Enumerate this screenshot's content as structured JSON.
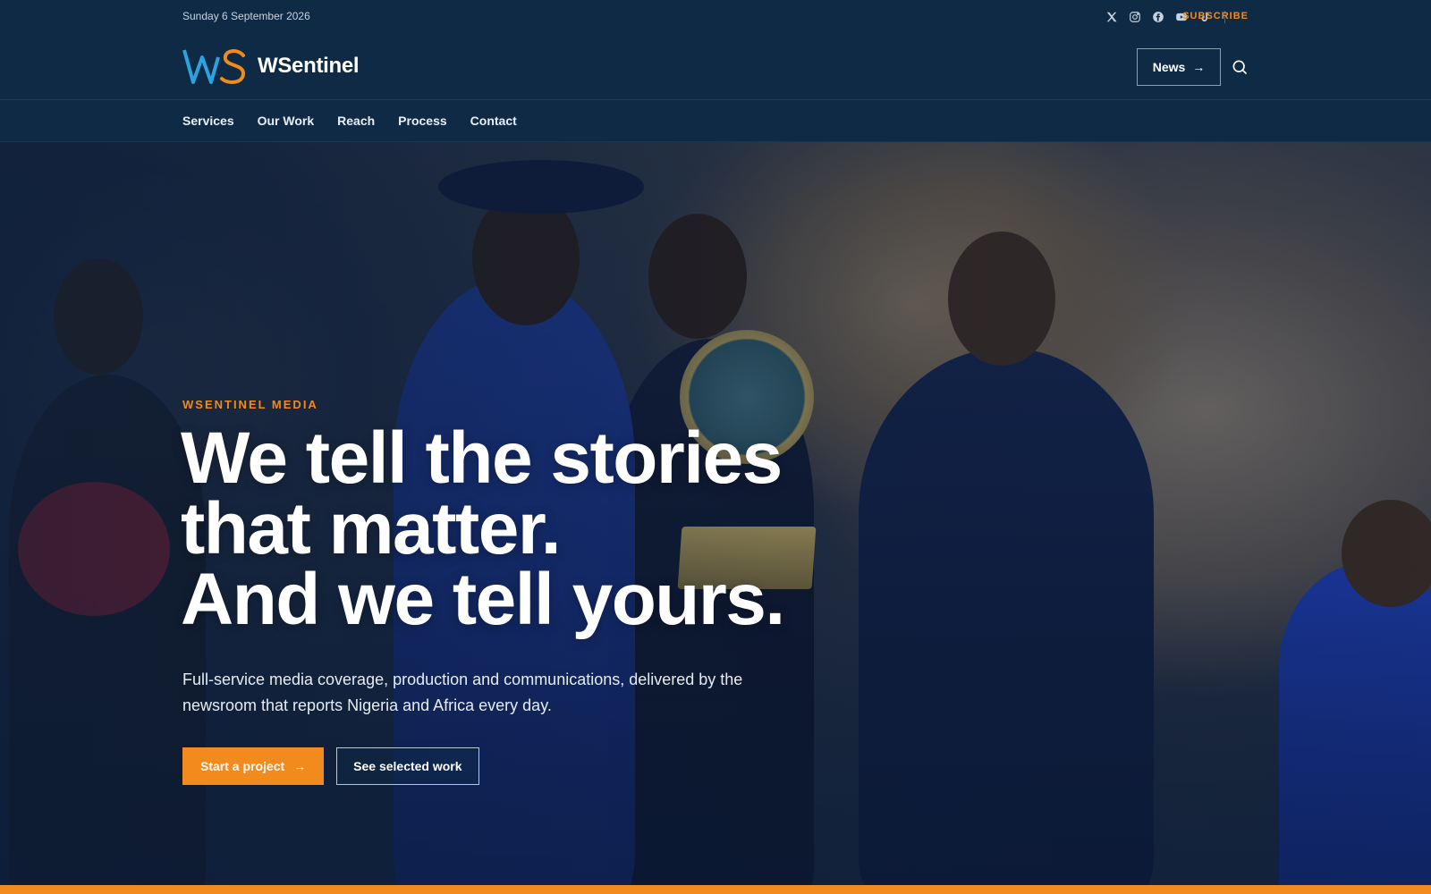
{
  "topbar": {
    "date": "Sunday 6 September 2026",
    "social_icons": [
      "x-icon",
      "instagram-icon",
      "facebook-icon",
      "youtube-icon",
      "tiktok-icon"
    ],
    "subscribe_label": "SUBSCRIBE"
  },
  "header": {
    "logo_text": "WSentinel",
    "news_button": "News",
    "search_icon": "search-icon"
  },
  "nav": {
    "items": [
      "Services",
      "Our Work",
      "Reach",
      "Process",
      "Contact"
    ]
  },
  "hero": {
    "eyebrow": "WSENTINEL MEDIA",
    "headline_line1": "We tell the stories",
    "headline_line2": "that matter.",
    "headline_line3": "And we tell yours.",
    "subtitle": "Full-service media coverage, production and communications, delivered by the newsroom that reports Nigeria and Africa every day.",
    "primary_cta": "Start a project",
    "secondary_cta": "See selected work"
  },
  "colors": {
    "navy": "#0e2a45",
    "accent_orange": "#f28a1e",
    "logo_blue": "#2aa3e0"
  }
}
